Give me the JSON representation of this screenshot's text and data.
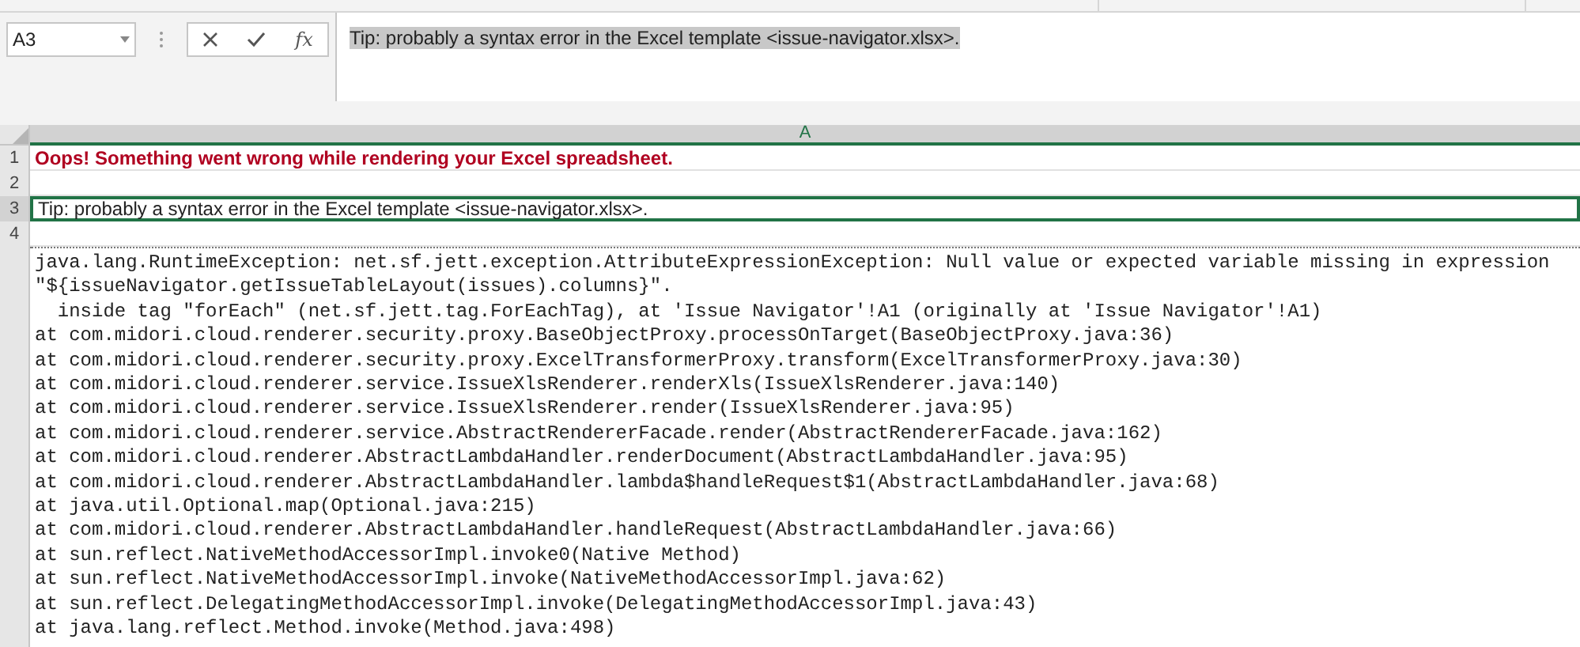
{
  "formula_bar": {
    "name_box": "A3",
    "function_button": "fx",
    "value": "Tip: probably a syntax error in the Excel template <issue-navigator.xlsx>."
  },
  "sheet": {
    "columns": [
      {
        "label": "A",
        "selected": true
      }
    ],
    "rows": [
      {
        "header": "1",
        "kind": "error",
        "text": "Oops! Something went wrong while rendering your Excel spreadsheet.",
        "selected": false
      },
      {
        "header": "2",
        "kind": "text",
        "text": "",
        "selected": false
      },
      {
        "header": "3",
        "kind": "text",
        "text": "Tip: probably a syntax error in the Excel template <issue-navigator.xlsx>.",
        "selected": true
      },
      {
        "header": "4",
        "kind": "text",
        "text": "",
        "selected": false
      },
      {
        "kind": "trace",
        "lines": [
          "java.lang.RuntimeException: net.sf.jett.exception.AttributeExpressionException: Null value or expected variable missing in expression",
          "\"${issueNavigator.getIssueTableLayout(issues).columns}\".",
          "  inside tag \"forEach\" (net.sf.jett.tag.ForEachTag), at 'Issue Navigator'!A1 (originally at 'Issue Navigator'!A1)",
          "at com.midori.cloud.renderer.security.proxy.BaseObjectProxy.processOnTarget(BaseObjectProxy.java:36)",
          "at com.midori.cloud.renderer.security.proxy.ExcelTransformerProxy.transform(ExcelTransformerProxy.java:30)",
          "at com.midori.cloud.renderer.service.IssueXlsRenderer.renderXls(IssueXlsRenderer.java:140)",
          "at com.midori.cloud.renderer.service.IssueXlsRenderer.render(IssueXlsRenderer.java:95)",
          "at com.midori.cloud.renderer.service.AbstractRendererFacade.render(AbstractRendererFacade.java:162)",
          "at com.midori.cloud.renderer.AbstractLambdaHandler.renderDocument(AbstractLambdaHandler.java:95)",
          "at com.midori.cloud.renderer.AbstractLambdaHandler.lambda$handleRequest$1(AbstractLambdaHandler.java:68)",
          "at java.util.Optional.map(Optional.java:215)",
          "at com.midori.cloud.renderer.AbstractLambdaHandler.handleRequest(AbstractLambdaHandler.java:66)",
          "at sun.reflect.NativeMethodAccessorImpl.invoke0(Native Method)",
          "at sun.reflect.NativeMethodAccessorImpl.invoke(NativeMethodAccessorImpl.java:62)",
          "at sun.reflect.DelegatingMethodAccessorImpl.invoke(DelegatingMethodAccessorImpl.java:43)",
          "at java.lang.reflect.Method.invoke(Method.java:498)"
        ]
      }
    ]
  }
}
